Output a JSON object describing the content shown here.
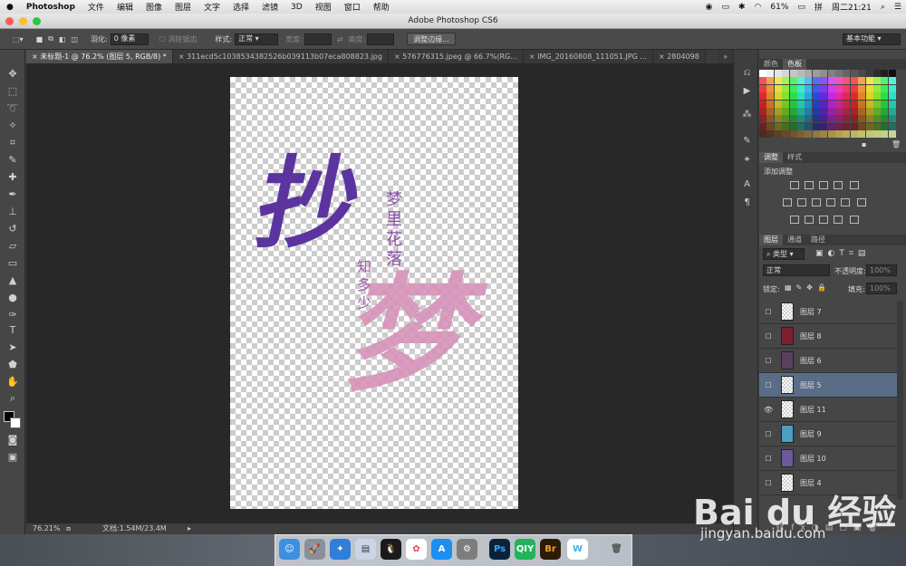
{
  "menubar": {
    "apple": "",
    "app": "Photoshop",
    "items": [
      "文件",
      "编辑",
      "图像",
      "图层",
      "文字",
      "选择",
      "滤镜",
      "3D",
      "视图",
      "窗口",
      "帮助"
    ],
    "battery": "61%",
    "clock": "周二21:21"
  },
  "window": {
    "title": "Adobe Photoshop CS6"
  },
  "options": {
    "feather_label": "羽化:",
    "feather_value": "0 像素",
    "antialias": "消除锯齿",
    "style_label": "样式:",
    "style_value": "正常",
    "width_label": "宽度:",
    "height_label": "高度:",
    "refine_button": "调整边缘...",
    "workspace": "基本功能"
  },
  "tabs": [
    {
      "label": "未标题-1 @ 76.2% (图层 5, RGB/8) *"
    },
    {
      "label": "311ecd5c1038534382526b039113b07eca808823.jpg"
    },
    {
      "label": "576776315.jpeg @ 66.7%(RG..."
    },
    {
      "label": "IMG_20160808_111051.JPG ..."
    },
    {
      "label": "2804098"
    }
  ],
  "status": {
    "zoom": "76.21%",
    "doc": "文档:1.54M/23.4M"
  },
  "panels": {
    "color_tab": "颜色",
    "swatch_tab": "色板",
    "adjust_tab": "调整",
    "style_tab": "样式",
    "add_adjust": "添加调整",
    "layers_tab": "图层",
    "channels_tab": "通道",
    "paths_tab": "路径",
    "kind": "类型",
    "blend_mode": "正常",
    "opacity_label": "不透明度:",
    "opacity_value": "100%",
    "lock_label": "锁定:",
    "fill_label": "填充:",
    "fill_value": "100%"
  },
  "layers": [
    {
      "name": "图层 7",
      "visible": false,
      "selected": false
    },
    {
      "name": "图层 8",
      "visible": false,
      "selected": false
    },
    {
      "name": "图层 6",
      "visible": false,
      "selected": false
    },
    {
      "name": "图层 5",
      "visible": false,
      "selected": true
    },
    {
      "name": "图层 11",
      "visible": true,
      "selected": false
    },
    {
      "name": "图层 9",
      "visible": false,
      "selected": false
    },
    {
      "name": "图层 10",
      "visible": false,
      "selected": false
    },
    {
      "name": "图层 4",
      "visible": false,
      "selected": false
    }
  ],
  "artwork": {
    "big1": "抄",
    "small_col1": "梦里花落",
    "small_col2": "知多少",
    "big2": "梦"
  },
  "watermark": {
    "logo": "Bai du 经验",
    "url": "jingyan.baidu.com"
  },
  "dock": [
    "Finder",
    "Launchpad",
    "Safari",
    "Preview",
    "QQ",
    "Photos",
    "App Store",
    "System Preferences",
    "Ps",
    "iQIYI",
    "Br",
    "Weibo",
    "Trash"
  ]
}
